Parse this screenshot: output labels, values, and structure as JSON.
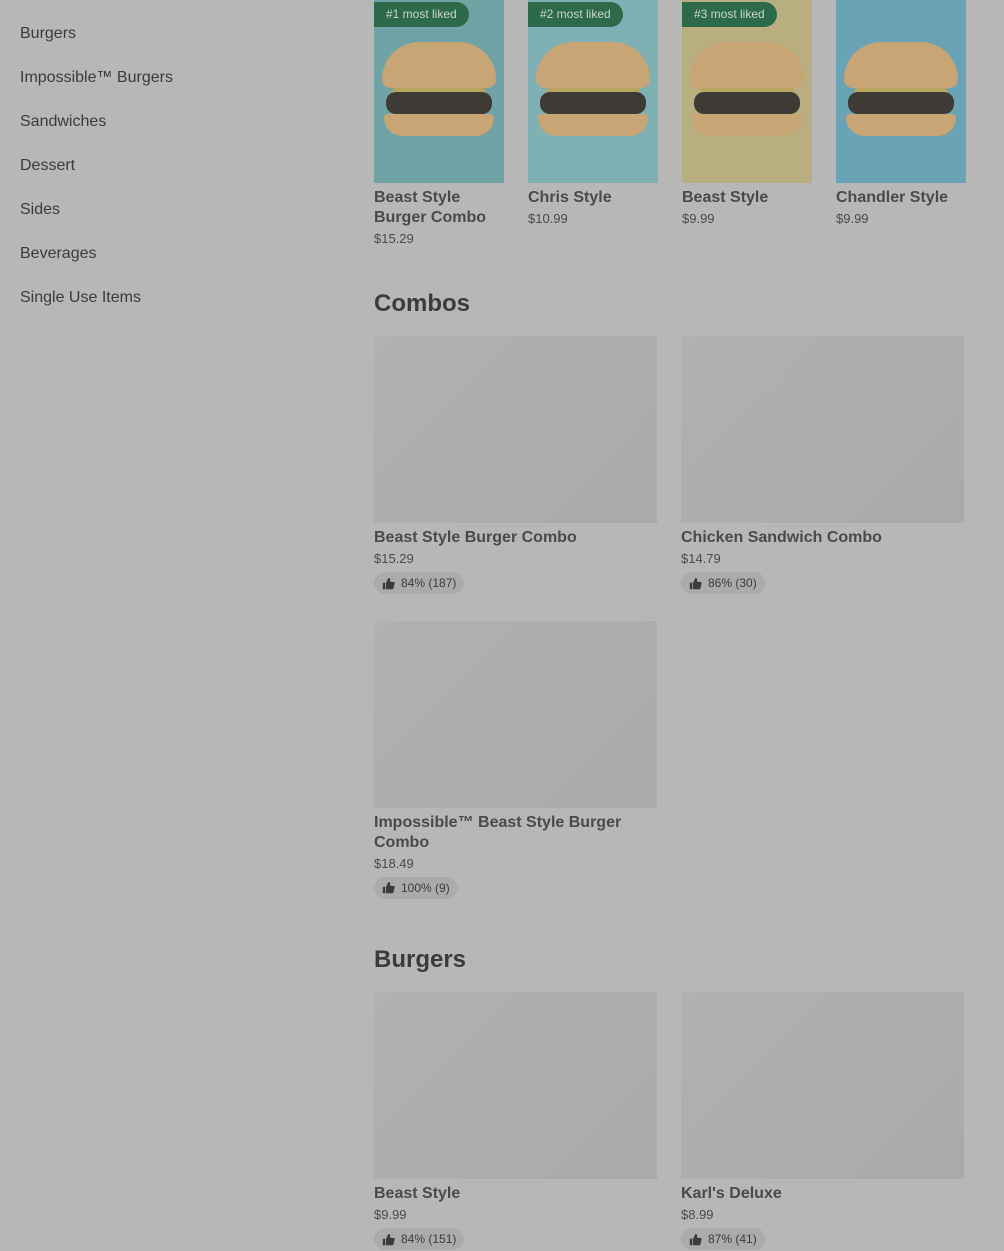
{
  "sidebar": {
    "items": [
      {
        "label": "Burgers"
      },
      {
        "label": "Impossible™ Burgers"
      },
      {
        "label": "Sandwiches"
      },
      {
        "label": "Dessert"
      },
      {
        "label": "Sides"
      },
      {
        "label": "Beverages"
      },
      {
        "label": "Single Use Items"
      }
    ]
  },
  "most_liked": [
    {
      "badge": "#1 most liked",
      "name": "Beast Style Burger Combo",
      "price": "$15.29",
      "bg": "#6fa3a6"
    },
    {
      "badge": "#2 most liked",
      "name": "Chris Style",
      "price": "$10.99",
      "bg": "#7fb0b3"
    },
    {
      "badge": "#3 most liked",
      "name": "Beast Style",
      "price": "$9.99",
      "bg": "#b9ae80"
    },
    {
      "badge": "",
      "name": "Chandler Style",
      "price": "$9.99",
      "bg": "#6aa3b6"
    }
  ],
  "combos": {
    "title": "Combos",
    "items": [
      {
        "name": "Beast Style Burger Combo",
        "price": "$15.29",
        "rating": "84% (187)"
      },
      {
        "name": "Chicken Sandwich Combo",
        "price": "$14.79",
        "rating": "86% (30)"
      },
      {
        "name": "Impossible™ Beast Style Burger Combo",
        "price": "$18.49",
        "rating": "100% (9)"
      }
    ]
  },
  "burgers": {
    "title": "Burgers",
    "items": [
      {
        "name": "Beast Style",
        "price": "$9.99",
        "rating": "84% (151)"
      },
      {
        "name": "Karl's Deluxe",
        "price": "$8.99",
        "rating": "87% (41)"
      }
    ]
  },
  "colors": {
    "badge_bg": "#2d6a4a",
    "overlay_bg": "#b7b7b7",
    "bun": "#c8a574"
  },
  "icons": {
    "rating": "thumbs-up-icon"
  }
}
